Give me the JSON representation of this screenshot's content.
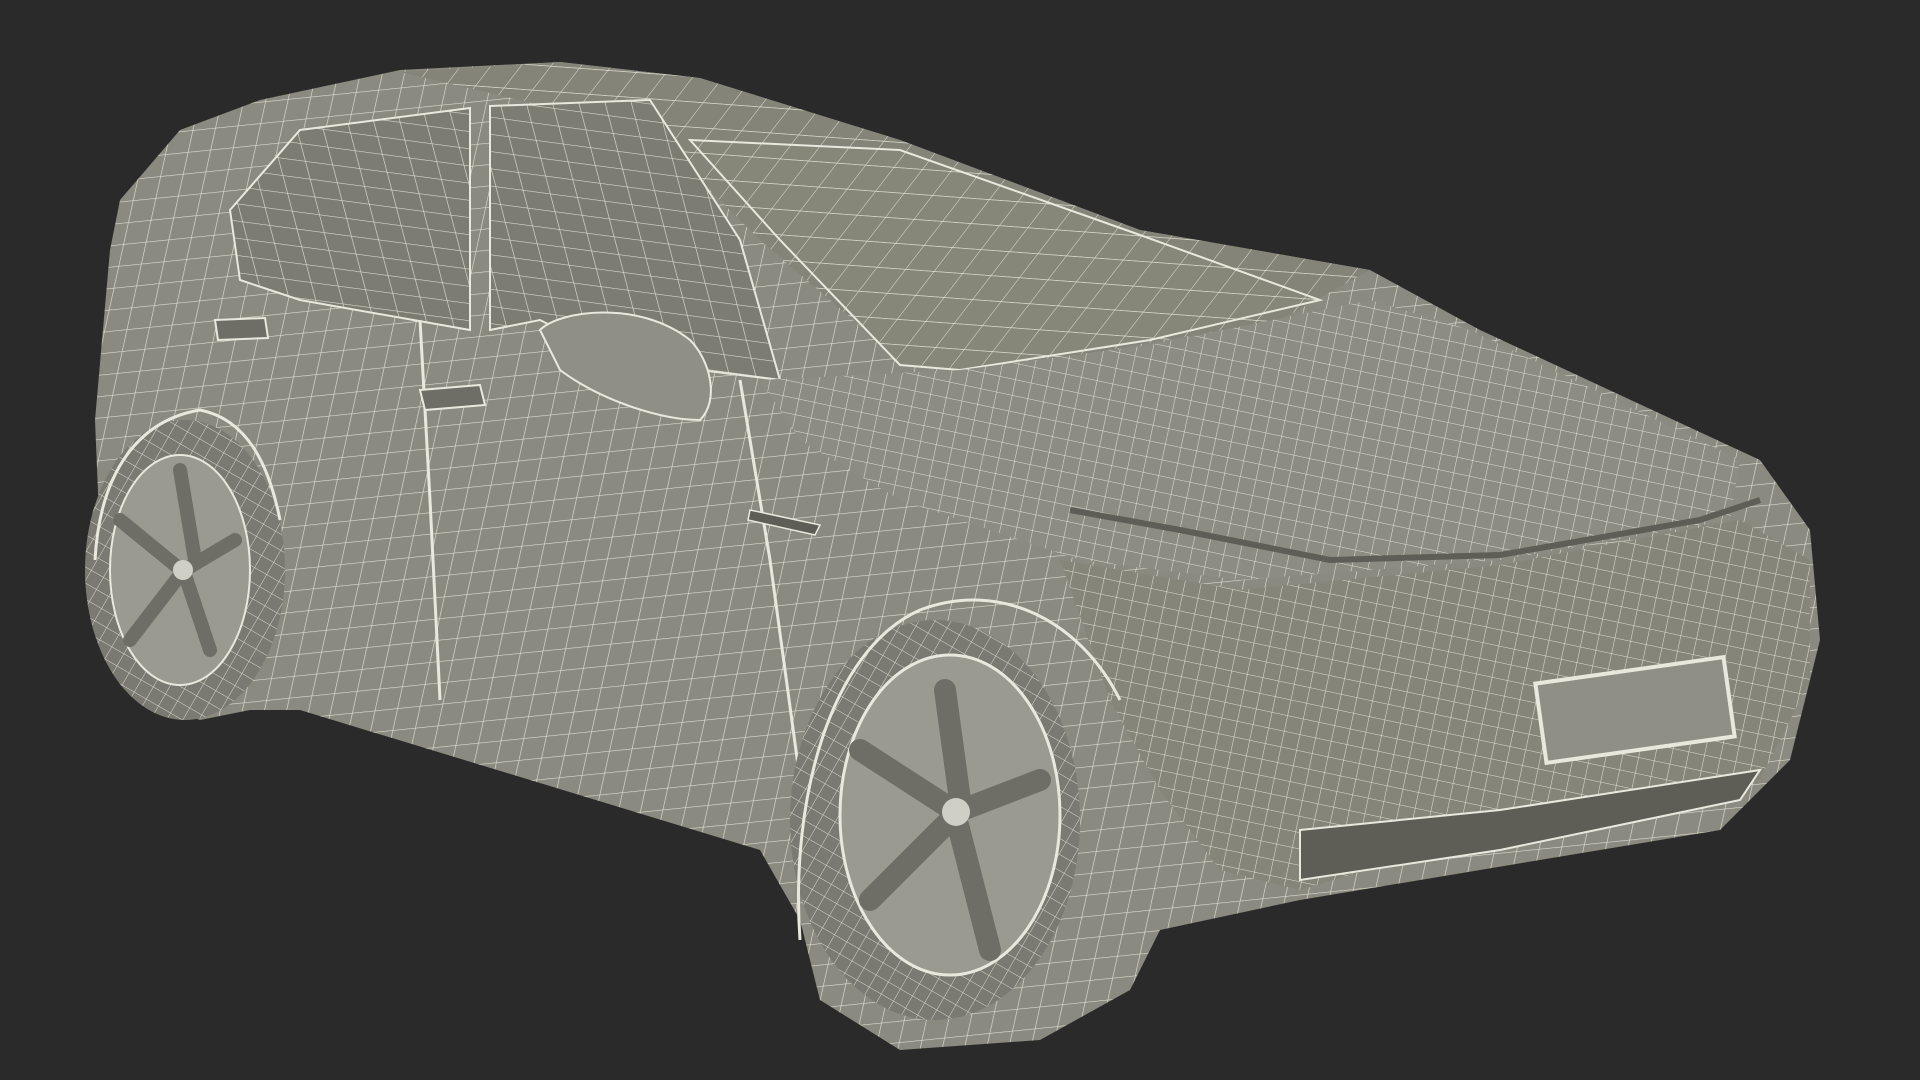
{
  "scene": {
    "background_color": "#2a2a2a",
    "body_color": "#8a8a80",
    "body_shadow_color": "#6e6e66",
    "wire_color": "#e8e8dc",
    "tire_color": "#7a7a72",
    "rim_color": "#9a9a90"
  }
}
